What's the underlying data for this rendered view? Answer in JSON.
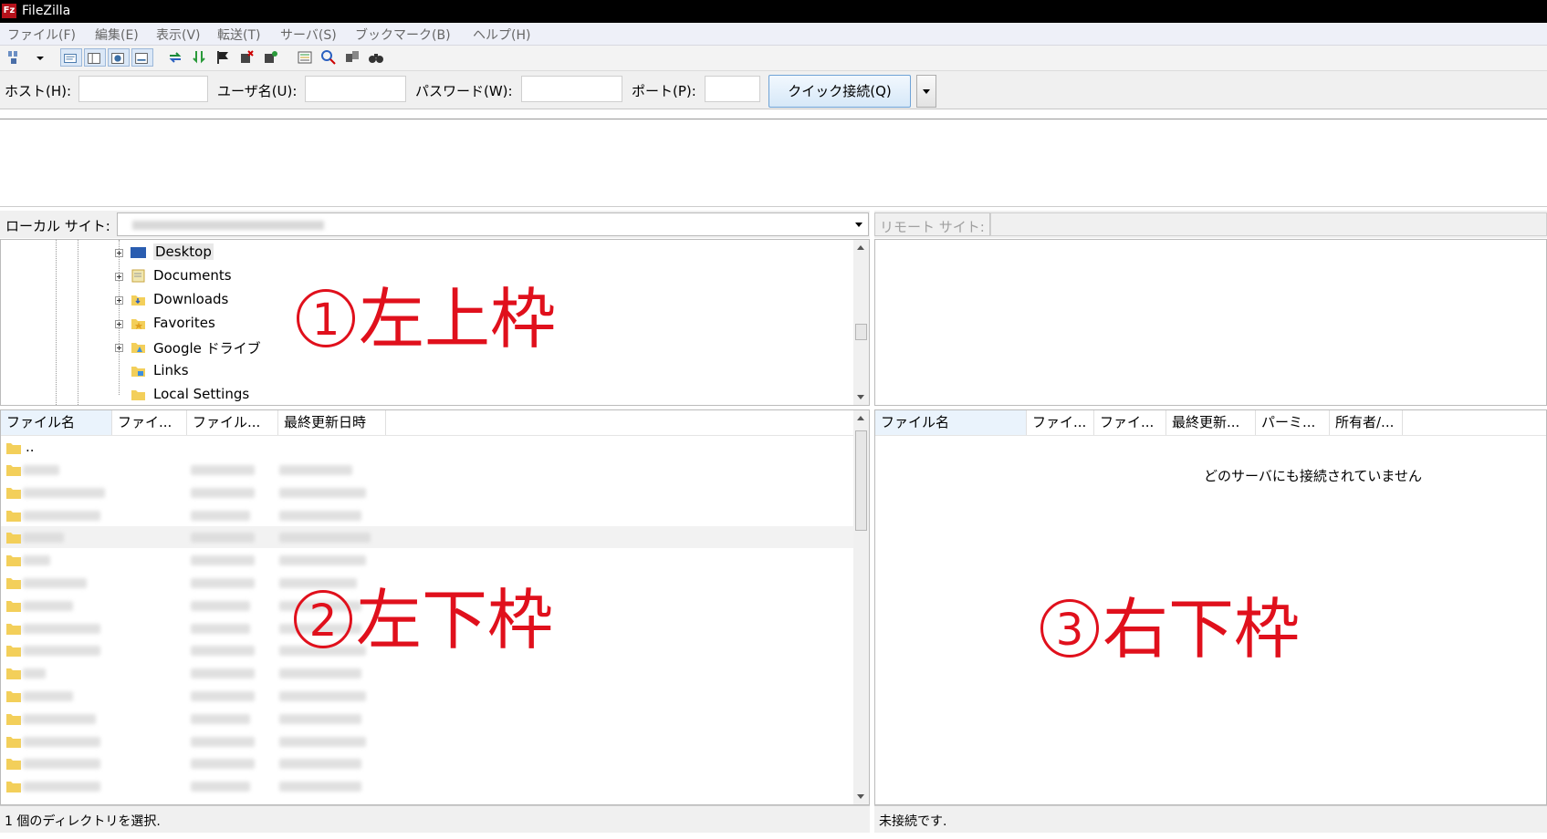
{
  "app": {
    "title": "FileZilla",
    "logo_text": "Fz"
  },
  "menu": [
    "ファイル(F)",
    "編集(E)",
    "表示(V)",
    "転送(T)",
    "サーバ(S)",
    "ブックマーク(B)",
    "ヘルプ(H)"
  ],
  "toolbar": {
    "icons": [
      "site-manager-icon",
      "dropdown-arrow-icon",
      "toggle-message-log-icon",
      "toggle-local-tree-icon",
      "toggle-remote-tree-icon",
      "toggle-transfer-queue-icon",
      "refresh-icon",
      "process-queue-icon",
      "cancel-operation-icon",
      "disconnect-icon",
      "reconnect-icon",
      "directory-filter-icon",
      "compare-directories-icon",
      "sync-browse-icon",
      "search-files-icon"
    ]
  },
  "quickconnect": {
    "host_label": "ホスト(H):",
    "host_value": "",
    "user_label": "ユーザ名(U):",
    "user_value": "",
    "password_label": "パスワード(W):",
    "password_value": "",
    "port_label": "ポート(P):",
    "port_value": "",
    "connect_button": "クイック接続(Q)"
  },
  "local": {
    "site_label": "ローカル サイト:",
    "tree": [
      {
        "name": "Desktop",
        "expandable": true,
        "icon": "desktop-folder-icon"
      },
      {
        "name": "Documents",
        "expandable": true,
        "icon": "documents-folder-icon"
      },
      {
        "name": "Downloads",
        "expandable": true,
        "icon": "downloads-folder-icon"
      },
      {
        "name": "Favorites",
        "expandable": true,
        "icon": "favorites-folder-icon"
      },
      {
        "name": "Google ドライブ",
        "expandable": true,
        "icon": "google-drive-folder-icon"
      },
      {
        "name": "Links",
        "expandable": false,
        "icon": "links-folder-icon"
      },
      {
        "name": "Local Settings",
        "expandable": false,
        "icon": "folder-icon"
      }
    ],
    "columns": [
      "ファイル名",
      "ファイ...",
      "ファイル...",
      "最終更新日時"
    ],
    "parent_dir": "..",
    "status": "1 個のディレクトリを選択."
  },
  "remote": {
    "site_label": "リモート サイト:",
    "columns": [
      "ファイル名",
      "ファイ...",
      "ファイ...",
      "最終更新...",
      "パーミ...",
      "所有者/..."
    ],
    "empty_message": "どのサーバにも接続されていません",
    "status": "未接続です."
  },
  "annotations": {
    "top_left": {
      "number": "1",
      "text": "左上枠"
    },
    "bottom_left": {
      "number": "2",
      "text": "左下枠"
    },
    "bottom_right": {
      "number": "3",
      "text": "右下枠"
    },
    "color": "#e0101c"
  }
}
